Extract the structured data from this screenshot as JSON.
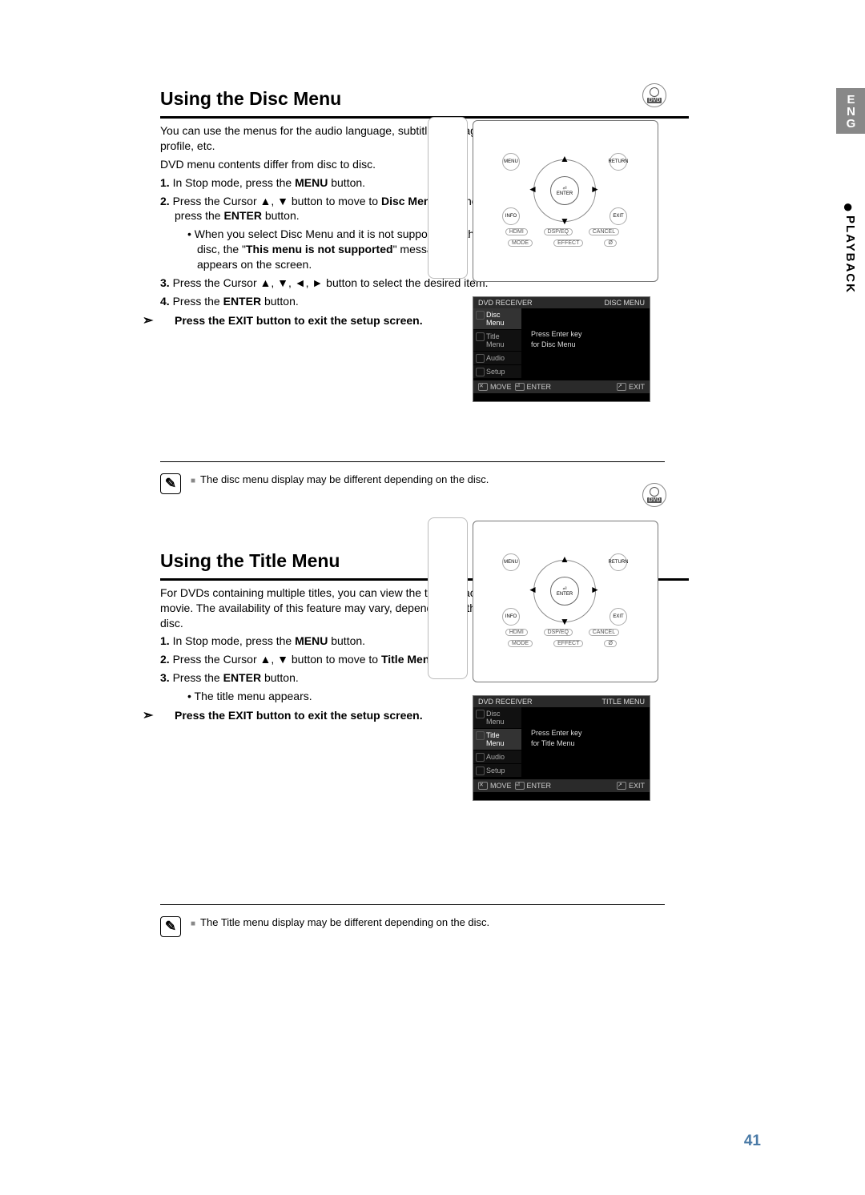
{
  "lang_tab": "ENG",
  "section_tab": "PLAYBACK",
  "page_number": "41",
  "disc_menu": {
    "heading": "Using the Disc Menu",
    "intro1": "You can use the menus for the audio language, subtitle language, profile, etc.",
    "intro2": "DVD menu contents differ from disc to disc.",
    "step1_a": "In Stop mode, press the ",
    "step1_b": "MENU",
    "step1_c": " button.",
    "step2_a": "Press the Cursor ▲, ▼ button to move to ",
    "step2_b": "Disc Menu",
    "step2_c": " and then press the ",
    "step2_d": "ENTER",
    "step2_e": " button.",
    "step2_bullet_a": "When you select Disc Menu and it is not supported by the disc, the \"",
    "step2_bullet_b": "This menu is not supported",
    "step2_bullet_c": "\" message appears on the screen.",
    "step3_a": "Press the Cursor ▲, ▼, ◄, ► button to select the desired item.",
    "step4_a": "Press the ",
    "step4_b": "ENTER",
    "step4_c": " button.",
    "exit_tip": "Press the EXIT button to exit the setup screen.",
    "note": "The disc menu display may be different depending on the disc.",
    "osd": {
      "brand": "DVD RECEIVER",
      "title": "DISC MENU",
      "items": [
        "Disc Menu",
        "Title Menu",
        "Audio",
        "Setup"
      ],
      "msg1": "Press Enter key",
      "msg2": "for Disc Menu",
      "foot_move": "MOVE",
      "foot_enter": "ENTER",
      "foot_exit": "EXIT"
    }
  },
  "title_menu": {
    "heading": "Using the Title Menu",
    "intro": "For DVDs containing multiple titles, you can view the title of each movie. The availability of this feature may vary, depending on the disc.",
    "step1_a": "In Stop mode, press the ",
    "step1_b": "MENU",
    "step1_c": " button.",
    "step2_a": "Press the Cursor ▲, ▼ button to move to ",
    "step2_b": "Title Menu",
    "step2_c": ".",
    "step3_a": "Press the ",
    "step3_b": "ENTER",
    "step3_c": " button.",
    "step3_bullet": "The title menu appears.",
    "exit_tip": "Press the EXIT button to exit the setup screen.",
    "note": "The Title menu display may be different depending on the disc.",
    "osd": {
      "brand": "DVD RECEIVER",
      "title": "TITLE MENU",
      "items": [
        "Disc Menu",
        "Title Menu",
        "Audio",
        "Setup"
      ],
      "msg1": "Press Enter key",
      "msg2": "for Title Menu",
      "foot_move": "MOVE",
      "foot_enter": "ENTER",
      "foot_exit": "EXIT"
    }
  },
  "dvd_badge": "DVD",
  "dpad": {
    "menu": "MENU",
    "return": "RETURN",
    "enter": "ENTER",
    "info": "INFO",
    "exit": "EXIT",
    "hdmi": "HDMI",
    "dspeq": "DSP/EQ",
    "cancel": "CANCEL",
    "mode": "MODE",
    "effect": "EFFECT",
    "slash": "Ø"
  }
}
